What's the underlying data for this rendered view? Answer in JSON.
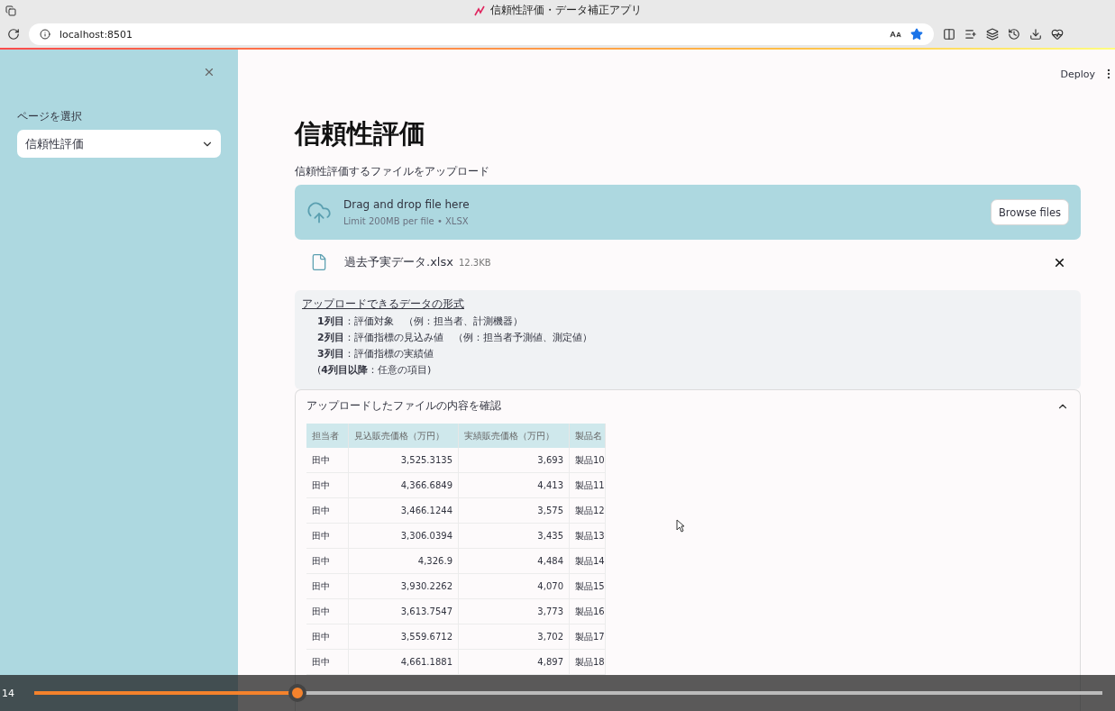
{
  "browser": {
    "tab_title": "信頼性評価・データ補正アプリ",
    "url": "localhost:8501"
  },
  "sidebar": {
    "select_label": "ページを選択",
    "select_value": "信頼性評価"
  },
  "header": {
    "deploy": "Deploy"
  },
  "main": {
    "title": "信頼性評価",
    "uploader_label": "信頼性評価するファイルをアップロード",
    "dropzone": {
      "title": "Drag and drop file here",
      "hint": "Limit 200MB per file • XLSX",
      "button": "Browse files"
    },
    "file": {
      "name": "過去予実データ.xlsx",
      "size": "12.3KB"
    },
    "format_box": {
      "heading": "アップロードできるデータの形式",
      "lines": [
        "**1列目**：評価対象　（例：担当者、計測機器）",
        "**2列目**：評価指標の見込み値　（例：担当者予測値、測定値）",
        "**3列目**：評価指標の実績値",
        "(**4列目以降**：任意の項目)"
      ]
    },
    "expander": {
      "title": "アップロードしたファイルの内容を確認",
      "expanded": true
    },
    "table": {
      "columns": [
        "担当者",
        "見込販売価格（万円）",
        "実績販売価格（万円）",
        "製品名"
      ],
      "rows": [
        [
          "田中",
          "3,525.3135",
          "3,693",
          "製品10"
        ],
        [
          "田中",
          "4,366.6849",
          "4,413",
          "製品11"
        ],
        [
          "田中",
          "3,466.1244",
          "3,575",
          "製品12"
        ],
        [
          "田中",
          "3,306.0394",
          "3,435",
          "製品13"
        ],
        [
          "田中",
          "4,326.9",
          "4,484",
          "製品14"
        ],
        [
          "田中",
          "3,930.2262",
          "4,070",
          "製品15"
        ],
        [
          "田中",
          "3,613.7547",
          "3,773",
          "製品16"
        ],
        [
          "田中",
          "3,559.6712",
          "3,702",
          "製品17"
        ],
        [
          "田中",
          "4,661.1881",
          "4,897",
          "製品18"
        ]
      ]
    }
  },
  "video": {
    "time": "14",
    "level": 0.246
  }
}
